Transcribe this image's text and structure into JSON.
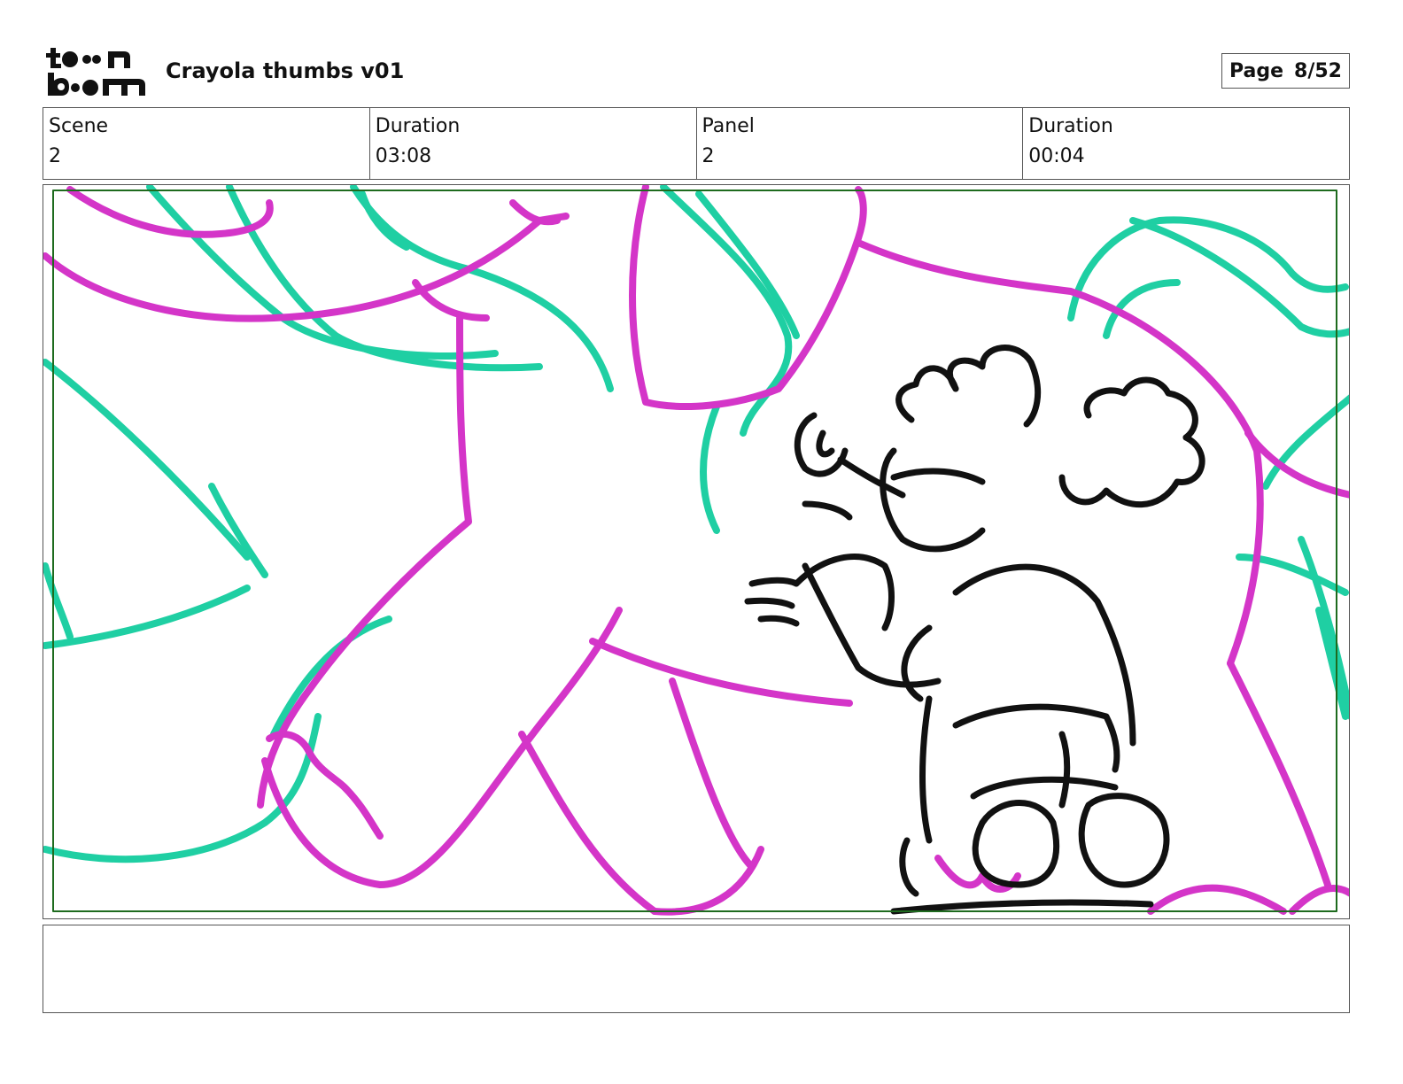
{
  "header": {
    "logo": {
      "line1": "toon",
      "line2": "boom"
    },
    "title": "Crayola thumbs v01",
    "page_label": "Page",
    "page_number": "8/52"
  },
  "info": {
    "scene": {
      "label": "Scene",
      "value": "2"
    },
    "scene_duration": {
      "label": "Duration",
      "value": "03:08"
    },
    "panel": {
      "label": "Panel",
      "value": "2"
    },
    "panel_duration": {
      "label": "Duration",
      "value": "00:04"
    }
  },
  "colors": {
    "magenta": "#d435c8",
    "teal": "#1fcfa3",
    "ink": "#111111",
    "safe_frame": "#1e6b1e"
  },
  "notes": {
    "text": ""
  }
}
